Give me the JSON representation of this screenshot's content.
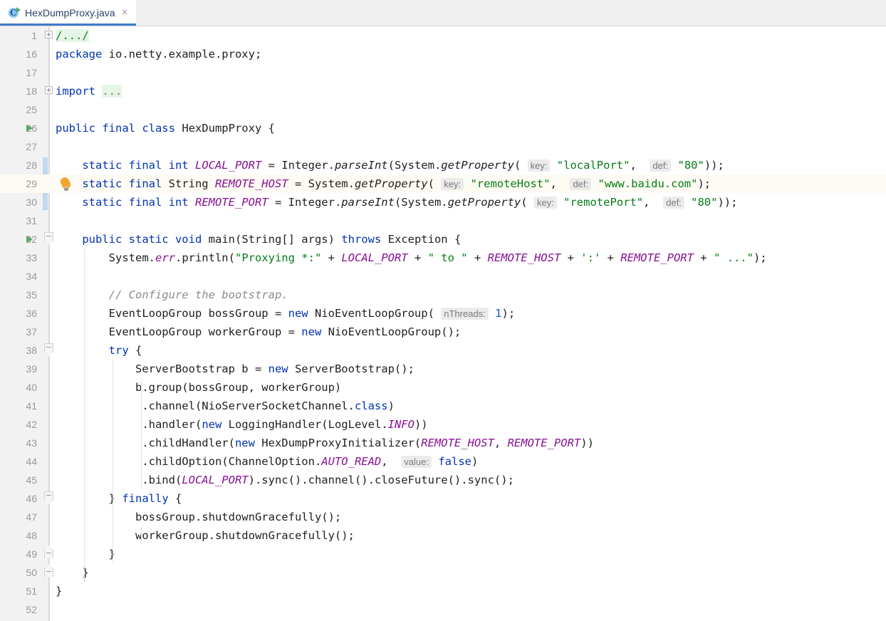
{
  "window": {
    "app": "IntelliJ IDEA Editor"
  },
  "tabbar": {
    "tabs": [
      {
        "title": "HexDumpProxy.java",
        "icon": "java-class-runnable-icon",
        "close_label": "×",
        "active": true
      }
    ]
  },
  "editor": {
    "gutter": {
      "line_numbers": [
        "1",
        "16",
        "17",
        "18",
        "25",
        "26",
        "27",
        "28",
        "29",
        "30",
        "31",
        "32",
        "33",
        "34",
        "35",
        "36",
        "37",
        "38",
        "39",
        "40",
        "41",
        "42",
        "43",
        "44",
        "45",
        "46",
        "47",
        "48",
        "49",
        "50",
        "51",
        "52"
      ],
      "run_marker_lines": [
        "26",
        "32"
      ],
      "bulb_line": "29",
      "fold_plus_lines": [
        "1",
        "18"
      ],
      "fold_minus_lines": [
        "32",
        "38",
        "46",
        "49",
        "50"
      ],
      "change_marker_lines": [
        "28",
        "29",
        "30"
      ]
    },
    "caret_line": "29",
    "colors": {
      "keyword": "#0033b3",
      "string": "#067d17",
      "number": "#1750eb",
      "comment": "#8c8c8c",
      "static_field": "#871094",
      "fold_background": "#e5f5e5",
      "hint_background": "#ebebeb",
      "caret_line_background": "#fdfbf3",
      "change_marker": "#c2d8ef",
      "tab_underline": "#3d7bcd",
      "run_marker": "#59a869",
      "bulb": "#f0a732"
    },
    "code_lines": [
      {
        "number": "1",
        "fold": "plus",
        "segments": [
          {
            "t": "/.../",
            "c": "fold-text"
          }
        ]
      },
      {
        "number": "16",
        "segments": [
          {
            "t": "package",
            "c": "kw"
          },
          {
            "t": " io.netty.example.proxy;",
            "c": ""
          }
        ]
      },
      {
        "number": "17",
        "segments": []
      },
      {
        "number": "18",
        "fold": "plus",
        "segments": [
          {
            "t": "import",
            "c": "kw"
          },
          {
            "t": " ",
            "c": ""
          },
          {
            "t": "...",
            "c": "fold-text dots"
          }
        ]
      },
      {
        "number": "25",
        "segments": []
      },
      {
        "number": "26",
        "run": true,
        "segments": [
          {
            "t": "public final class",
            "c": "kw"
          },
          {
            "t": " HexDumpProxy {",
            "c": ""
          }
        ]
      },
      {
        "number": "27",
        "segments": []
      },
      {
        "number": "28",
        "segments": [
          {
            "t": "    ",
            "c": ""
          },
          {
            "t": "static final int",
            "c": "kw"
          },
          {
            "t": " ",
            "c": ""
          },
          {
            "t": "LOCAL_PORT",
            "c": "fld"
          },
          {
            "t": " = Integer.",
            "c": ""
          },
          {
            "t": "parseInt",
            "c": "meth"
          },
          {
            "t": "(System.",
            "c": ""
          },
          {
            "t": "getProperty",
            "c": "meth"
          },
          {
            "t": "( ",
            "c": ""
          },
          {
            "t": "key:",
            "c": "hint"
          },
          {
            "t": " ",
            "c": ""
          },
          {
            "t": "\"localPort\"",
            "c": "str"
          },
          {
            "t": ",  ",
            "c": ""
          },
          {
            "t": "def:",
            "c": "hint"
          },
          {
            "t": " ",
            "c": ""
          },
          {
            "t": "\"80\"",
            "c": "str"
          },
          {
            "t": "));",
            "c": ""
          }
        ]
      },
      {
        "number": "29",
        "caret": true,
        "bulb": true,
        "segments": [
          {
            "t": "    ",
            "c": ""
          },
          {
            "t": "static final",
            "c": "kw"
          },
          {
            "t": " String ",
            "c": ""
          },
          {
            "t": "REMOTE_HOST",
            "c": "fld"
          },
          {
            "t": " = System.",
            "c": ""
          },
          {
            "t": "getProperty",
            "c": "meth"
          },
          {
            "t": "( ",
            "c": ""
          },
          {
            "t": "key:",
            "c": "hint"
          },
          {
            "t": " ",
            "c": ""
          },
          {
            "t": "\"remoteHost\"",
            "c": "str"
          },
          {
            "t": ",  ",
            "c": ""
          },
          {
            "t": "def:",
            "c": "hint"
          },
          {
            "t": " ",
            "c": ""
          },
          {
            "t": "\"www.baidu.com\"",
            "c": "str"
          },
          {
            "t": ");",
            "c": ""
          }
        ]
      },
      {
        "number": "30",
        "segments": [
          {
            "t": "    ",
            "c": ""
          },
          {
            "t": "static final int",
            "c": "kw"
          },
          {
            "t": " ",
            "c": ""
          },
          {
            "t": "REMOTE_PORT",
            "c": "fld"
          },
          {
            "t": " = Integer.",
            "c": ""
          },
          {
            "t": "parseInt",
            "c": "meth"
          },
          {
            "t": "(System.",
            "c": ""
          },
          {
            "t": "getProperty",
            "c": "meth"
          },
          {
            "t": "( ",
            "c": ""
          },
          {
            "t": "key:",
            "c": "hint"
          },
          {
            "t": " ",
            "c": ""
          },
          {
            "t": "\"remotePort\"",
            "c": "str"
          },
          {
            "t": ",  ",
            "c": ""
          },
          {
            "t": "def:",
            "c": "hint"
          },
          {
            "t": " ",
            "c": ""
          },
          {
            "t": "\"80\"",
            "c": "str"
          },
          {
            "t": "));",
            "c": ""
          }
        ]
      },
      {
        "number": "31",
        "segments": []
      },
      {
        "number": "32",
        "run": true,
        "fold": "minus",
        "segments": [
          {
            "t": "    ",
            "c": ""
          },
          {
            "t": "public static void",
            "c": "kw"
          },
          {
            "t": " ",
            "c": ""
          },
          {
            "t": "main",
            "c": ""
          },
          {
            "t": "(String[] args) ",
            "c": ""
          },
          {
            "t": "throws",
            "c": "kw"
          },
          {
            "t": " Exception {",
            "c": ""
          }
        ]
      },
      {
        "number": "33",
        "segments": [
          {
            "t": "        System.",
            "c": ""
          },
          {
            "t": "err",
            "c": "stat"
          },
          {
            "t": ".println(",
            "c": ""
          },
          {
            "t": "\"Proxying *:\"",
            "c": "str"
          },
          {
            "t": " + ",
            "c": ""
          },
          {
            "t": "LOCAL_PORT",
            "c": "fld"
          },
          {
            "t": " + ",
            "c": ""
          },
          {
            "t": "\" to \"",
            "c": "str"
          },
          {
            "t": " + ",
            "c": ""
          },
          {
            "t": "REMOTE_HOST",
            "c": "fld"
          },
          {
            "t": " + ",
            "c": ""
          },
          {
            "t": "':'",
            "c": "str"
          },
          {
            "t": " + ",
            "c": ""
          },
          {
            "t": "REMOTE_PORT",
            "c": "fld"
          },
          {
            "t": " + ",
            "c": ""
          },
          {
            "t": "\" ...\"",
            "c": "str"
          },
          {
            "t": ");",
            "c": ""
          }
        ]
      },
      {
        "number": "34",
        "segments": []
      },
      {
        "number": "35",
        "segments": [
          {
            "t": "        ",
            "c": ""
          },
          {
            "t": "// Configure the bootstrap.",
            "c": "cmt"
          }
        ]
      },
      {
        "number": "36",
        "segments": [
          {
            "t": "        EventLoopGroup bossGroup = ",
            "c": ""
          },
          {
            "t": "new",
            "c": "kw"
          },
          {
            "t": " NioEventLoopGroup( ",
            "c": ""
          },
          {
            "t": "nThreads:",
            "c": "hint"
          },
          {
            "t": " ",
            "c": ""
          },
          {
            "t": "1",
            "c": "num"
          },
          {
            "t": ");",
            "c": ""
          }
        ]
      },
      {
        "number": "37",
        "segments": [
          {
            "t": "        EventLoopGroup workerGroup = ",
            "c": ""
          },
          {
            "t": "new",
            "c": "kw"
          },
          {
            "t": " NioEventLoopGroup();",
            "c": ""
          }
        ]
      },
      {
        "number": "38",
        "fold": "minus",
        "segments": [
          {
            "t": "        ",
            "c": ""
          },
          {
            "t": "try",
            "c": "kw"
          },
          {
            "t": " {",
            "c": ""
          }
        ]
      },
      {
        "number": "39",
        "segments": [
          {
            "t": "            ServerBootstrap b = ",
            "c": ""
          },
          {
            "t": "new",
            "c": "kw"
          },
          {
            "t": " ServerBootstrap();",
            "c": ""
          }
        ]
      },
      {
        "number": "40",
        "segments": [
          {
            "t": "            b.group(bossGroup, workerGroup)",
            "c": ""
          }
        ]
      },
      {
        "number": "41",
        "segments": [
          {
            "t": "             .channel(NioServerSocketChannel.",
            "c": ""
          },
          {
            "t": "class",
            "c": "kw"
          },
          {
            "t": ")",
            "c": ""
          }
        ]
      },
      {
        "number": "42",
        "segments": [
          {
            "t": "             .handler(",
            "c": ""
          },
          {
            "t": "new",
            "c": "kw"
          },
          {
            "t": " LoggingHandler(LogLevel.",
            "c": ""
          },
          {
            "t": "INFO",
            "c": "fld"
          },
          {
            "t": "))",
            "c": ""
          }
        ]
      },
      {
        "number": "43",
        "segments": [
          {
            "t": "             .childHandler(",
            "c": ""
          },
          {
            "t": "new",
            "c": "kw"
          },
          {
            "t": " HexDumpProxyInitializer(",
            "c": ""
          },
          {
            "t": "REMOTE_HOST",
            "c": "fld"
          },
          {
            "t": ", ",
            "c": ""
          },
          {
            "t": "REMOTE_PORT",
            "c": "fld"
          },
          {
            "t": "))",
            "c": ""
          }
        ]
      },
      {
        "number": "44",
        "segments": [
          {
            "t": "             .childOption(ChannelOption.",
            "c": ""
          },
          {
            "t": "AUTO_READ",
            "c": "fld"
          },
          {
            "t": ",  ",
            "c": ""
          },
          {
            "t": "value:",
            "c": "hint"
          },
          {
            "t": " ",
            "c": ""
          },
          {
            "t": "false",
            "c": "kw"
          },
          {
            "t": ")",
            "c": ""
          }
        ]
      },
      {
        "number": "45",
        "segments": [
          {
            "t": "             .bind(",
            "c": ""
          },
          {
            "t": "LOCAL_PORT",
            "c": "fld"
          },
          {
            "t": ").sync().channel().closeFuture().sync();",
            "c": ""
          }
        ]
      },
      {
        "number": "46",
        "fold": "minus",
        "segments": [
          {
            "t": "        } ",
            "c": ""
          },
          {
            "t": "finally",
            "c": "kw"
          },
          {
            "t": " {",
            "c": ""
          }
        ]
      },
      {
        "number": "47",
        "segments": [
          {
            "t": "            bossGroup.shutdownGracefully();",
            "c": ""
          }
        ]
      },
      {
        "number": "48",
        "segments": [
          {
            "t": "            workerGroup.shutdownGracefully();",
            "c": ""
          }
        ]
      },
      {
        "number": "49",
        "fold": "minus-up",
        "segments": [
          {
            "t": "        }",
            "c": ""
          }
        ]
      },
      {
        "number": "50",
        "fold": "minus-up",
        "segments": [
          {
            "t": "    }",
            "c": ""
          }
        ]
      },
      {
        "number": "51",
        "segments": [
          {
            "t": "}",
            "c": ""
          }
        ]
      },
      {
        "number": "52",
        "segments": []
      }
    ]
  }
}
